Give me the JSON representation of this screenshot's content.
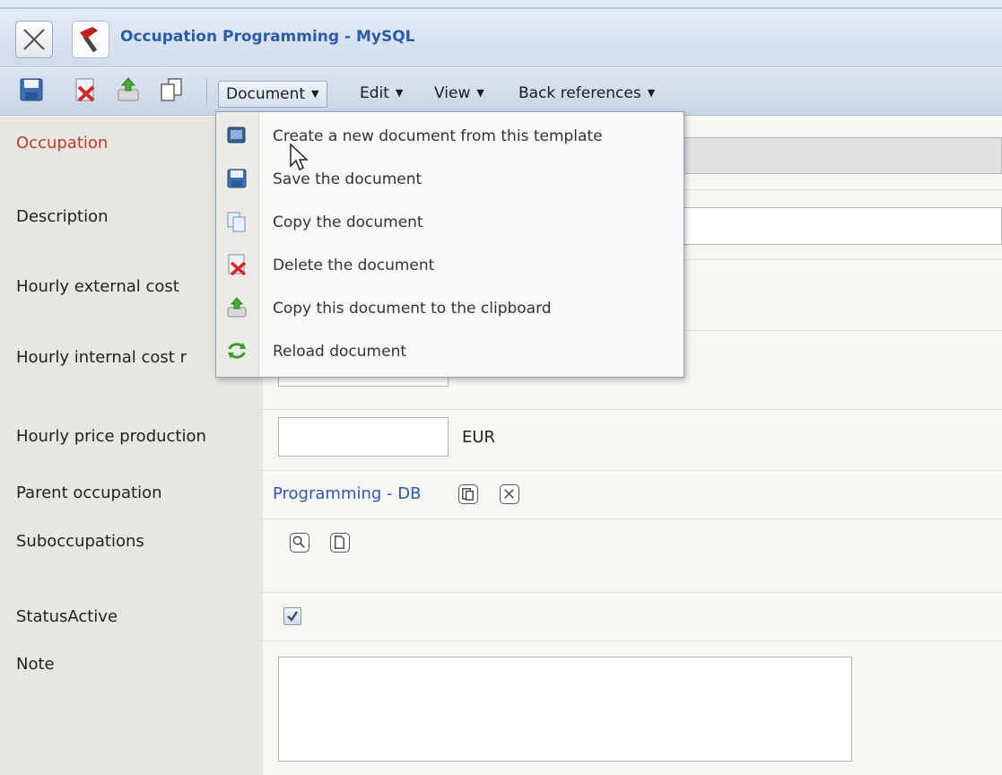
{
  "window": {
    "title": "Occupation Programming - MySQL"
  },
  "toolbar": {
    "icons": [
      "save-icon",
      "delete-icon",
      "clipboard-icon",
      "copy-icon"
    ],
    "menus": [
      {
        "label": "Document",
        "active": true
      },
      {
        "label": "Edit"
      },
      {
        "label": "View"
      },
      {
        "label": "Back references"
      }
    ]
  },
  "document_menu": {
    "items": [
      {
        "label": "Create a new document from this template",
        "icon": "new-from-template-icon"
      },
      {
        "label": "Save the document",
        "icon": "save-icon"
      },
      {
        "label": "Copy the document",
        "icon": "copy-icon"
      },
      {
        "label": "Delete the document",
        "icon": "delete-icon"
      },
      {
        "label": "Copy this document to the clipboard",
        "icon": "clipboard-icon"
      },
      {
        "label": "Reload document",
        "icon": "reload-icon"
      }
    ]
  },
  "form": {
    "occupation": {
      "label": "Occupation",
      "value": ""
    },
    "description": {
      "label": "Description",
      "value": ""
    },
    "hourly_external_cost": {
      "label": "Hourly external cost",
      "value": ""
    },
    "hourly_internal_cost": {
      "label": "Hourly internal cost r",
      "value": ""
    },
    "hourly_price_production": {
      "label": "Hourly price production",
      "value": "",
      "unit": "EUR"
    },
    "parent_occupation": {
      "label": "Parent occupation",
      "value": "Programming - DB"
    },
    "suboccupations": {
      "label": "Suboccupations"
    },
    "status_active": {
      "label": "StatusActive",
      "checked": true
    },
    "note": {
      "label": "Note",
      "value": ""
    }
  },
  "colors": {
    "title": "#2d5ca6",
    "required_label": "#c0392b",
    "link": "#2e58a8"
  }
}
